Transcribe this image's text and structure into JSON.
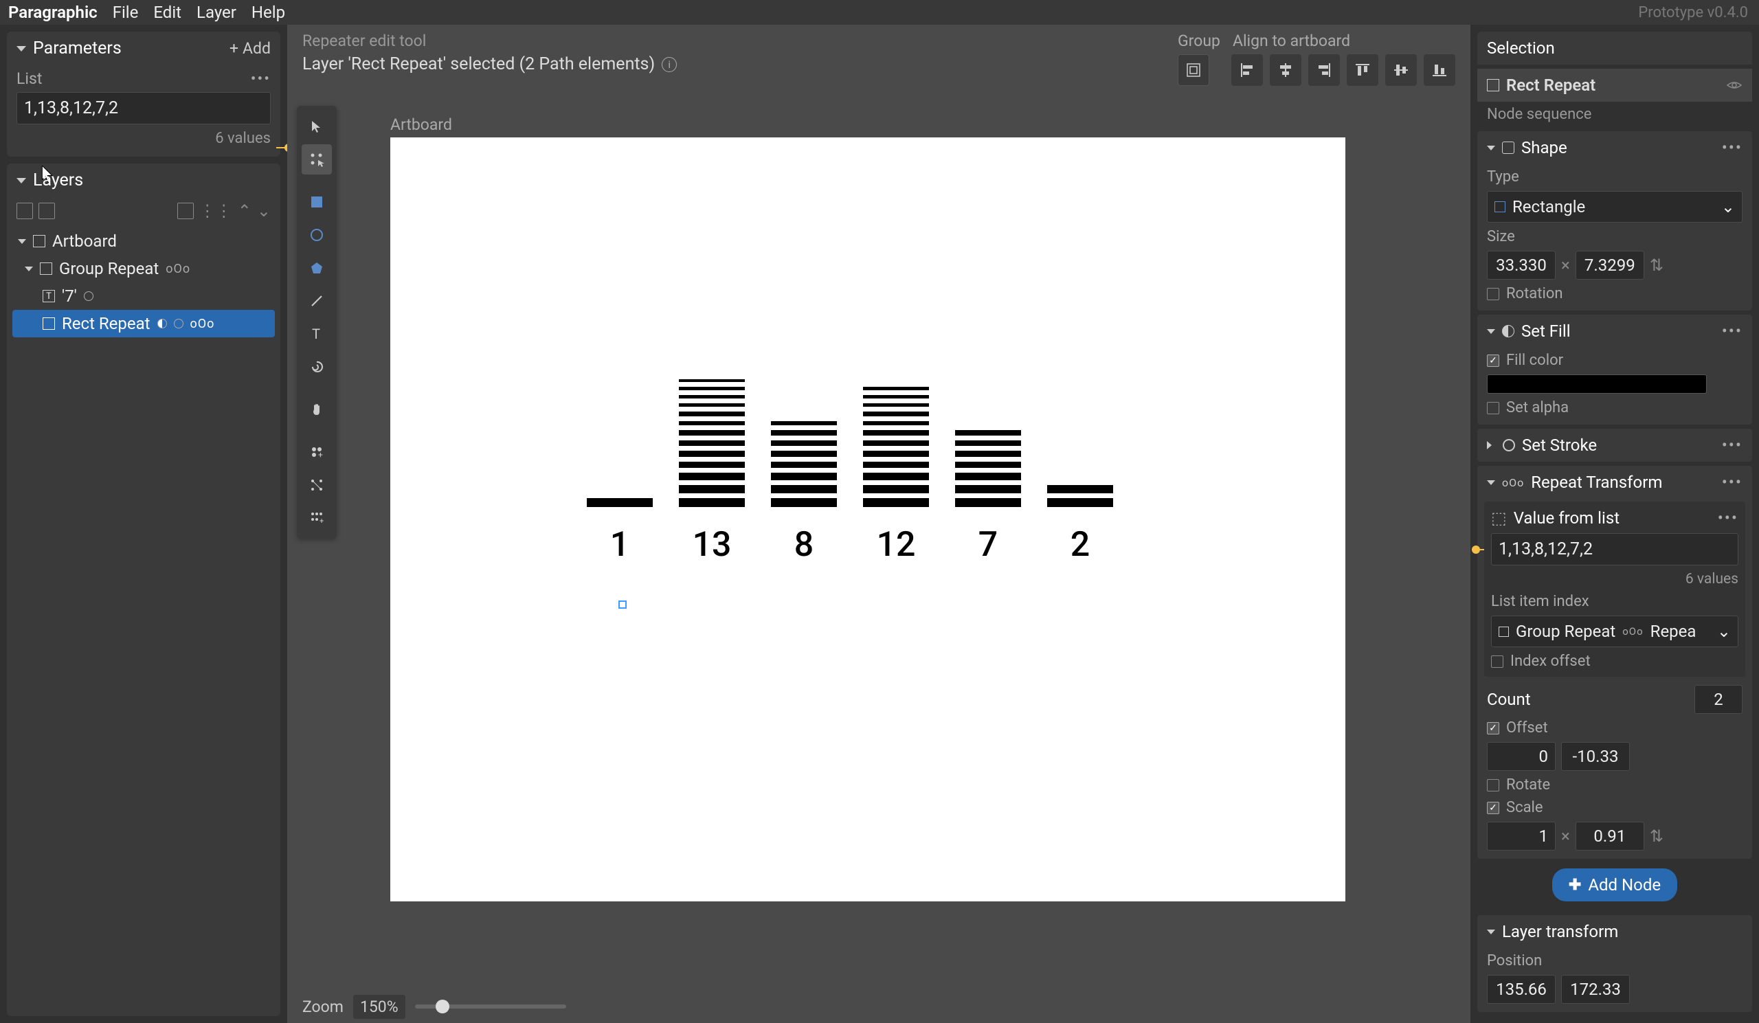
{
  "app": {
    "name": "Paragraphic",
    "version": "Prototype v0.4.0"
  },
  "menu": {
    "file": "File",
    "edit": "Edit",
    "layer": "Layer",
    "help": "Help"
  },
  "parameters": {
    "title": "Parameters",
    "add": "Add",
    "list_label": "List",
    "list_value": "1,13,8,12,7,2",
    "meta": "6 values"
  },
  "layers": {
    "title": "Layers",
    "artboard": "Artboard",
    "group_repeat": "Group Repeat",
    "text7": "'7'",
    "rect_repeat": "Rect Repeat"
  },
  "context": {
    "tool": "Repeater edit tool",
    "selection": "Layer 'Rect Repeat' selected (2 Path elements)",
    "group_label": "Group",
    "align_label": "Align to artboard"
  },
  "artboard": {
    "label": "Artboard"
  },
  "chart_data": {
    "type": "bar",
    "categories": [
      "1",
      "13",
      "8",
      "12",
      "7",
      "2"
    ],
    "values": [
      1,
      13,
      8,
      12,
      7,
      2
    ],
    "title": "",
    "xlabel": "",
    "ylabel": "",
    "ylim": [
      0,
      13
    ]
  },
  "zoom": {
    "label": "Zoom",
    "value": "150%"
  },
  "selection": {
    "title": "Selection",
    "layer_name": "Rect Repeat",
    "node_seq": "Node sequence",
    "shape": {
      "title": "Shape",
      "type_label": "Type",
      "type_value": "Rectangle",
      "size_label": "Size",
      "w": "33.330",
      "h": "7.3299",
      "rotation_label": "Rotation"
    },
    "fill": {
      "title": "Set Fill",
      "fill_color_label": "Fill color",
      "set_alpha_label": "Set alpha"
    },
    "stroke": {
      "title": "Set Stroke"
    },
    "repeat": {
      "title": "Repeat Transform",
      "value_from_list": "Value from list",
      "list_value": "1,13,8,12,7,2",
      "meta": "6 values",
      "index_label": "List item index",
      "index_value": "Group Repeat",
      "index_suffix": "Repea",
      "index_offset": "Index offset",
      "count_label": "Count",
      "count_value": "2",
      "offset_label": "Offset",
      "offset_x": "0",
      "offset_y": "-10.33",
      "rotate_label": "Rotate",
      "scale_label": "Scale",
      "scale_x": "1",
      "scale_y": "0.91",
      "add_node": "Add Node"
    },
    "layer_transform": {
      "title": "Layer transform",
      "position_label": "Position",
      "pos_x": "135.66",
      "pos_y": "172.33"
    }
  }
}
